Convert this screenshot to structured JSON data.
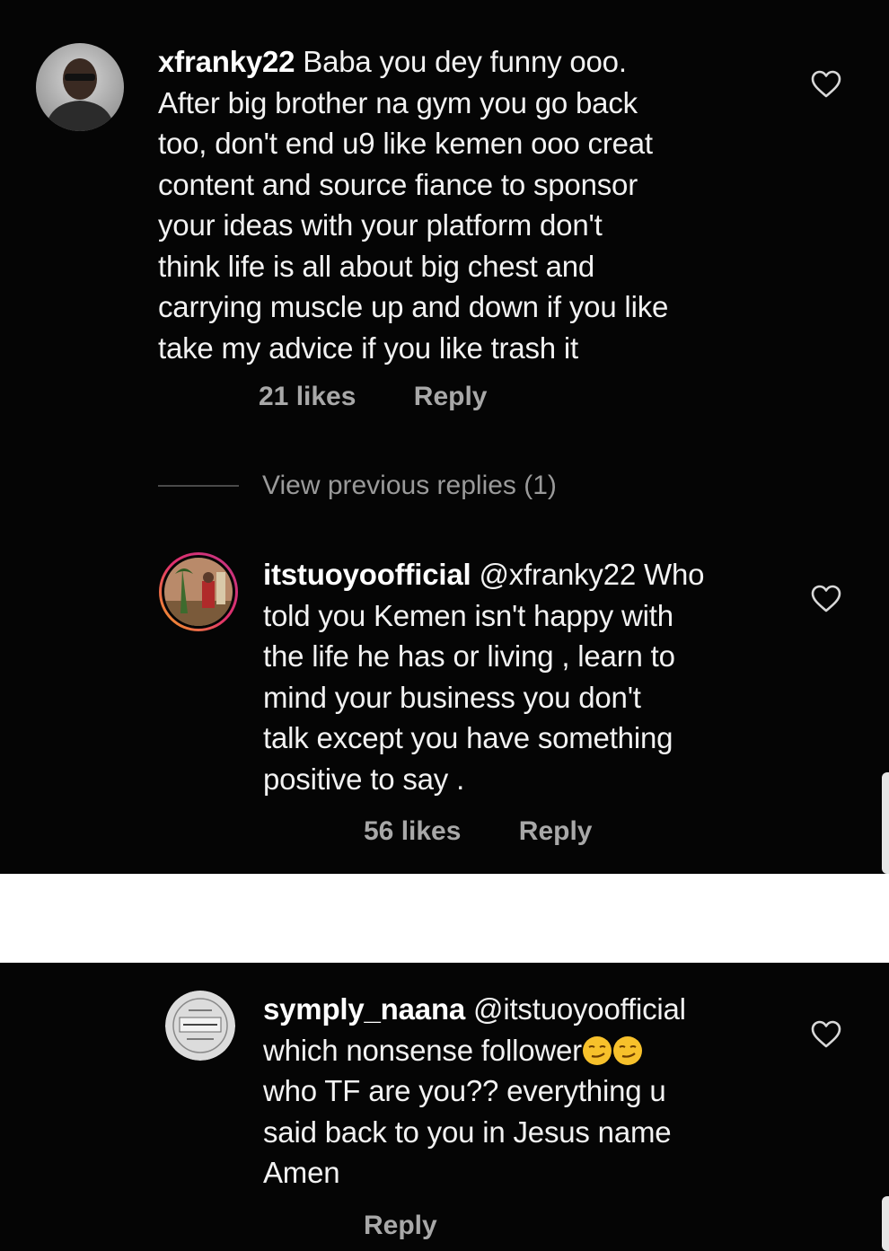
{
  "comments": [
    {
      "username": "xfranky22",
      "lines": [
        " Baba you dey funny ooo.",
        "After big brother na gym you go back",
        "too,  don't end u9 like kemen ooo creat",
        "content and source fiance to sponsor",
        "your ideas with your platform don't",
        "think life is all about big chest and",
        "carrying muscle up and down if you like",
        "take my advice if you like trash it"
      ],
      "likes": "21 likes",
      "reply": "Reply",
      "avatar_icon": "profile-photo-man-with-sunglasses",
      "like_icon": "heart-outline-icon"
    },
    {
      "username": "itstuoyoofficial",
      "lines": [
        " @xfranky22 Who",
        "told you Kemen isn't happy with",
        "the life he has or living , learn to",
        "mind your business you don't",
        "talk except you have something",
        "positive to say ."
      ],
      "likes": "56 likes",
      "reply": "Reply",
      "avatar_icon": "profile-photo-with-story-ring",
      "like_icon": "heart-outline-icon"
    },
    {
      "username": "symply_naana",
      "lines": [
        " @itstuoyoofficial",
        "which nonsense follower",
        "who TF are you?? everything u",
        "said back to you in Jesus name",
        "Amen"
      ],
      "emoji": "smirking-face-emoji",
      "reply": "Reply",
      "avatar_icon": "profile-photo-badge",
      "like_icon": "heart-outline-icon"
    }
  ],
  "view_previous_replies": "View previous replies (1)",
  "colors": {
    "background": "#050505",
    "text": "#f2f2f2",
    "meta": "#a8a8a8",
    "story_ring": "#c13584"
  }
}
